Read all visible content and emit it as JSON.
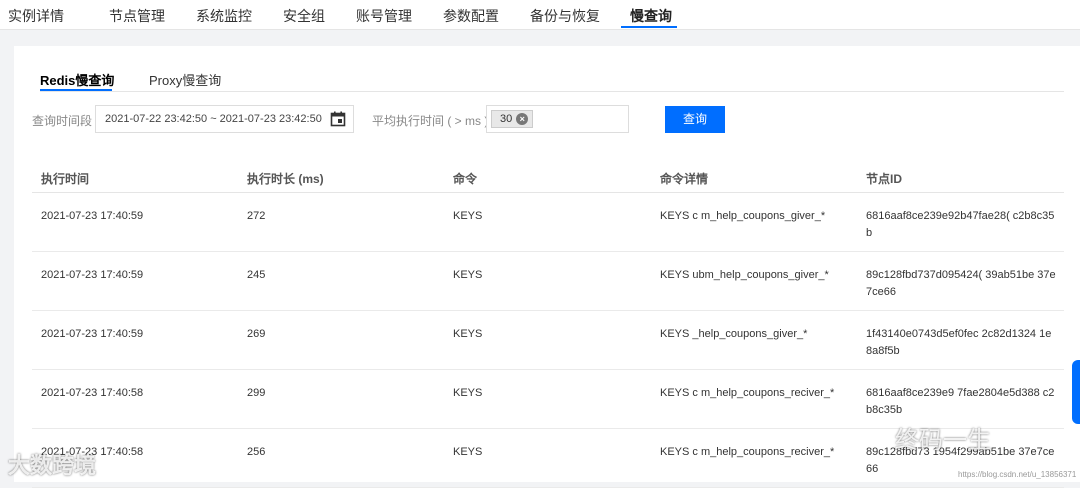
{
  "top_tabs": [
    "实例详情",
    "节点管理",
    "系统监控",
    "安全组",
    "账号管理",
    "参数配置",
    "备份与恢复",
    "慢查询"
  ],
  "sub_tabs": [
    "Redis慢查询",
    "Proxy慢查询"
  ],
  "filters": {
    "time_label": "查询时间段",
    "time_range": "2021-07-22 23:42:50 ~ 2021-07-23 23:42:50",
    "avg_label": "平均执行时间 ( > ms )",
    "avg_tag": "30",
    "query_button": "查询"
  },
  "table": {
    "headers": [
      "执行时间",
      "执行时长 (ms)",
      "命令",
      "命令详情",
      "节点ID"
    ],
    "rows": [
      {
        "time": "2021-07-23 17:40:59",
        "duration": "272",
        "command": "KEYS",
        "detail": "KEYS c m_help_coupons_giver_*",
        "node": "6816aaf8ce239e92b47fae28(  c2b8c35b"
      },
      {
        "time": "2021-07-23 17:40:59",
        "duration": "245",
        "command": "KEYS",
        "detail": "KEYS ubm_help_coupons_giver_*",
        "node": "89c128fbd737d095424(  39ab51be 37e7ce66"
      },
      {
        "time": "2021-07-23 17:40:59",
        "duration": "269",
        "command": "KEYS",
        "detail": "KEYS  _help_coupons_giver_*",
        "node": "1f43140e0743d5ef0fec  2c82d1324 1e8a8f5b"
      },
      {
        "time": "2021-07-23 17:40:58",
        "duration": "299",
        "command": "KEYS",
        "detail": "KEYS c m_help_coupons_reciver_*",
        "node": "6816aaf8ce239e9  7fae2804e5d388 c2b8c35b"
      },
      {
        "time": "2021-07-23 17:40:58",
        "duration": "256",
        "command": "KEYS",
        "detail": "KEYS c m_help_coupons_reciver_*",
        "node": "89c128fbd73  1954f299ab51be 37e7ce66"
      }
    ]
  },
  "watermarks": {
    "left": "大数跨境",
    "right": "终码一生",
    "url": "https://blog.csdn.net/u_13856371"
  },
  "colors": {
    "accent": "#006eff"
  },
  "icons": {
    "calendar": "calendar-icon",
    "tag_remove": "close-circle-icon"
  }
}
